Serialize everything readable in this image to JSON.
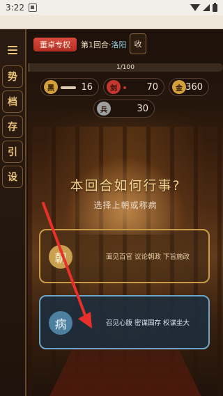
{
  "status_bar": {
    "time": "3:22"
  },
  "sidebar": {
    "menu_icon": "menu-icon",
    "items": [
      {
        "label": "势"
      },
      {
        "label": "档"
      },
      {
        "label": "存"
      },
      {
        "label": "引"
      },
      {
        "label": "设"
      }
    ]
  },
  "header": {
    "faction_button": "董卓专权",
    "round_prefix": "第1回合·",
    "location": "洛阳",
    "collect_button": "收"
  },
  "progress": {
    "text": "1/100",
    "value": 1,
    "max": 100
  },
  "stats": [
    {
      "icon": "黑",
      "value": "16",
      "icon_color": "#d4a03a",
      "bar_fraction": 0.16
    },
    {
      "icon": "剑",
      "value": "70",
      "icon_color": "#c8352c",
      "bar_fraction": 0.05
    },
    {
      "icon": "金",
      "value": "360",
      "icon_color": "#d4a03a"
    },
    {
      "icon": "兵",
      "value": "30",
      "icon_color": "#a0a0a0"
    }
  ],
  "prompt": {
    "question": "本回合如何行事?",
    "subtitle": "选择上朝或称病"
  },
  "choices": [
    {
      "badge": "朝",
      "description": "面见百官 议论朝政 下旨施政"
    },
    {
      "badge": "病",
      "description": "召见心腹 密谋国存 权谋坐大"
    }
  ],
  "colors": {
    "accent_red": "#c8352c",
    "accent_gold": "#c99a48",
    "accent_blue": "#6fa6c8",
    "arrow": "#e8302a"
  }
}
